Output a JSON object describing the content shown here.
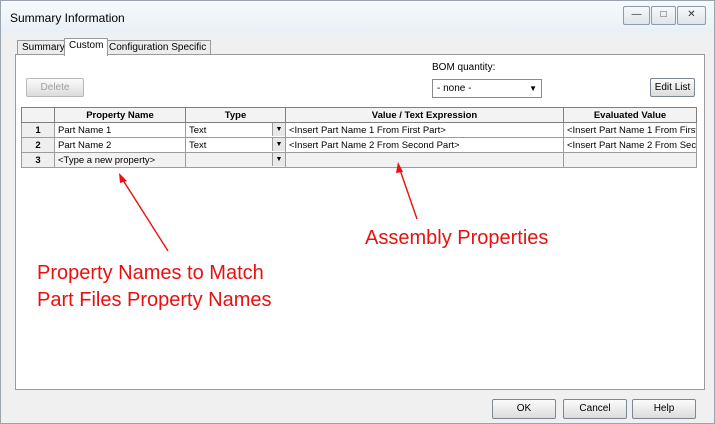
{
  "window": {
    "title": "Summary Information"
  },
  "tabs": [
    {
      "label": "Summary"
    },
    {
      "label": "Custom"
    },
    {
      "label": "Configuration Specific"
    }
  ],
  "toolbar": {
    "delete_label": "Delete",
    "bom_label": "BOM quantity:",
    "bom_value": "- none -",
    "edit_list_label": "Edit List"
  },
  "table": {
    "headers": [
      "",
      "Property Name",
      "Type",
      "Value / Text Expression",
      "Evaluated Value"
    ],
    "rows": [
      {
        "num": "1",
        "name": "Part Name 1",
        "type": "Text",
        "value": "<Insert Part Name 1 From First Part>",
        "evaluated": "<Insert Part Name 1 From First"
      },
      {
        "num": "2",
        "name": "Part Name 2",
        "type": "Text",
        "value": "<Insert Part Name 2 From Second Part>",
        "evaluated": "<Insert Part Name 2 From Sec"
      },
      {
        "num": "3",
        "name": "<Type a new property>",
        "type": "",
        "value": "",
        "evaluated": ""
      }
    ]
  },
  "annotations": {
    "left_line1": "Property Names to Match",
    "left_line2": "Part Files Property Names",
    "right": "Assembly Properties",
    "color": "#e8110f"
  },
  "footer": {
    "ok_label": "OK",
    "cancel_label": "Cancel",
    "help_label": "Help"
  }
}
